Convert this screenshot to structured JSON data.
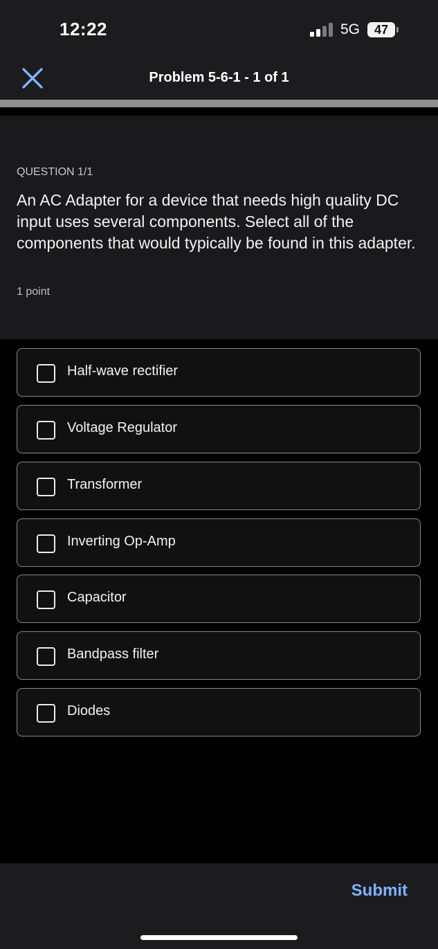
{
  "status_bar": {
    "time": "12:22",
    "network": "5G",
    "battery": "47"
  },
  "nav": {
    "title": "Problem 5-6-1 - 1 of 1",
    "progress_fraction": 1
  },
  "question": {
    "label": "QUESTION 1/1",
    "text": "An AC Adapter for a device that needs high quality DC input uses several components. Select all of the components that would typically be found in this adapter.",
    "points": "1 point"
  },
  "options": [
    {
      "label": "Half-wave rectifier",
      "checked": false
    },
    {
      "label": "Voltage Regulator",
      "checked": false
    },
    {
      "label": "Transformer",
      "checked": false
    },
    {
      "label": "Inverting Op-Amp",
      "checked": false
    },
    {
      "label": "Capacitor",
      "checked": false
    },
    {
      "label": "Bandpass filter",
      "checked": false
    },
    {
      "label": "Diodes",
      "checked": false
    }
  ],
  "footer": {
    "submit_label": "Submit"
  },
  "colors": {
    "accent": "#7fb2ff",
    "background": "#000000",
    "card": "#1a1a1c"
  },
  "icons": {
    "close": "close-icon",
    "signal": "cellular-signal-icon",
    "battery": "battery-icon",
    "checkbox": "checkbox-unchecked-icon"
  }
}
